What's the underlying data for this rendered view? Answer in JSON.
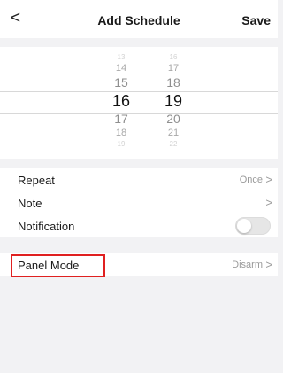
{
  "header": {
    "back_icon": "chevron-left-icon",
    "back_glyph": "<",
    "title": "Add Schedule",
    "save_label": "Save"
  },
  "time_picker": {
    "hours": [
      "13",
      "14",
      "15",
      "16",
      "17",
      "18",
      "19"
    ],
    "minutes": [
      "16",
      "17",
      "18",
      "19",
      "20",
      "21",
      "22"
    ],
    "selected_hour": "16",
    "selected_minute": "19"
  },
  "settings": {
    "repeat": {
      "label": "Repeat",
      "value": "Once",
      "chevron": ">"
    },
    "note": {
      "label": "Note",
      "chevron": ">"
    },
    "notification": {
      "label": "Notification",
      "enabled": false
    },
    "panel_mode": {
      "label": "Panel Mode",
      "value": "Disarm",
      "chevron": ">"
    }
  },
  "colors": {
    "highlight_border": "#e02020",
    "background": "#f2f2f4"
  }
}
